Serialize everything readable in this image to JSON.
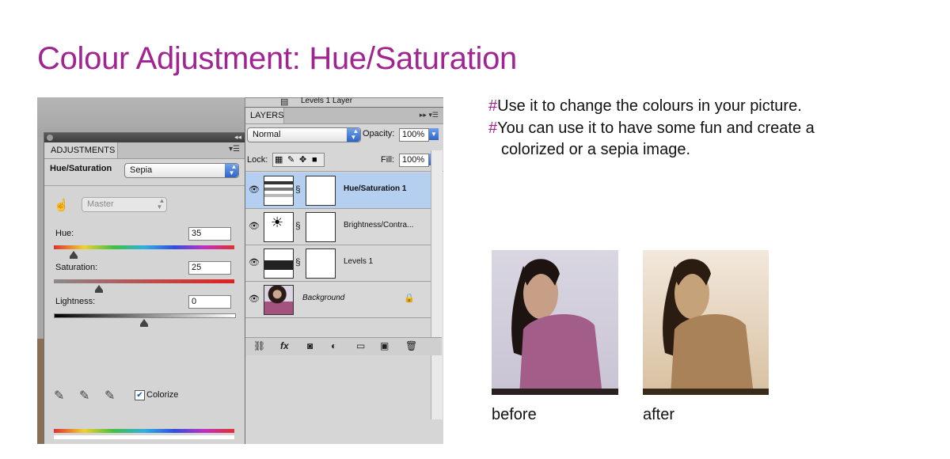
{
  "slide": {
    "title": "Colour Adjustment: Hue/Saturation",
    "bullets": [
      {
        "marker": "#",
        "text": "Use it to change the colours in your picture."
      },
      {
        "marker": "#",
        "text": "You can use it to have some fun and create a",
        "continuation": "colorized or a sepia image."
      }
    ]
  },
  "adjustments_panel": {
    "tab_label": "ADJUSTMENTS",
    "adjustment_label": "Hue/Saturation",
    "preset_value": "Sepia",
    "channel_value": "Master",
    "hue": {
      "label": "Hue:",
      "value": "35",
      "slider_fraction": 0.11
    },
    "saturation": {
      "label": "Saturation:",
      "value": "25",
      "slider_fraction": 0.25
    },
    "lightness": {
      "label": "Lightness:",
      "value": "0",
      "slider_fraction": 0.5
    },
    "colorize": {
      "label": "Colorize",
      "checked": true
    }
  },
  "layers_panel": {
    "above_label": "Levels 1 Layer",
    "tab_label": "LAYERS",
    "blend_mode": "Normal",
    "opacity_label": "Opacity:",
    "opacity_value": "100%",
    "lock_label": "Lock:",
    "fill_label": "Fill:",
    "fill_value": "100%",
    "layers": [
      {
        "name": "Hue/Saturation 1",
        "selected": true,
        "icon": "hue-saturation-icon"
      },
      {
        "name": "Brightness/Contra...",
        "selected": false,
        "icon": "brightness-contrast-icon"
      },
      {
        "name": "Levels 1",
        "selected": false,
        "icon": "levels-icon"
      },
      {
        "name": "Background",
        "selected": false,
        "icon": "photo-thumbnail",
        "locked": true
      }
    ]
  },
  "photos": {
    "before_caption": "before",
    "after_caption": "after"
  },
  "colors": {
    "title": "#a02591",
    "bullet_marker": "#a02591",
    "selected_layer": "#b4cff0"
  }
}
